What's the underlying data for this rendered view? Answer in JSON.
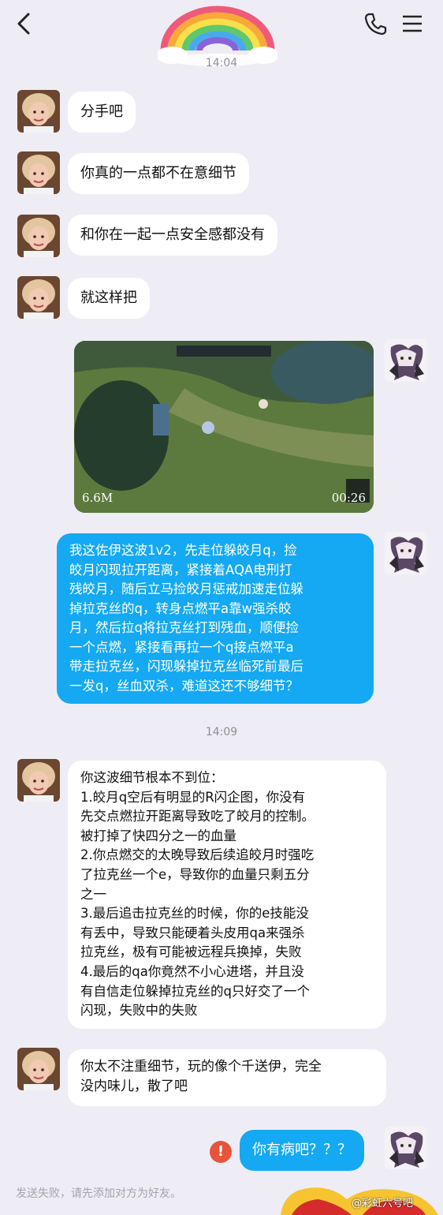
{
  "header": {
    "back_icon": "chevron-left-icon",
    "phone_icon": "phone-icon",
    "menu_icon": "hamburger-menu-icon",
    "decoration": "rainbow"
  },
  "timestamps": [
    "14:04",
    "14:09"
  ],
  "messages": [
    {
      "side": "left",
      "text": "分手吧"
    },
    {
      "side": "left",
      "text": "你真的一点都不在意细节"
    },
    {
      "side": "left",
      "text": "和你在一起一点安全感都没有"
    },
    {
      "side": "left",
      "text": "就这样把"
    },
    {
      "side": "right",
      "type": "video",
      "size": "6.6M",
      "duration": "00:26"
    },
    {
      "side": "right",
      "lines": [
        "我这佐伊这波1v2，先走位躲皎月q，捡",
        "皎月闪现拉开距离，紧接着AQA电刑打",
        "残皎月，随后立马捡皎月惩戒加速走位躲",
        "掉拉克丝的q，转身点燃平a靠w强杀皎",
        "月，然后拉q将拉克丝打到残血，顺便捡",
        "一个点燃，紧接看再拉一个q接点燃平a",
        "带走拉克丝，闪现躲掉拉克丝临死前最后",
        "一发q，丝血双杀，难道这还不够细节？"
      ]
    },
    {
      "side": "left",
      "lines": [
        "你这波细节根本不到位：",
        "1.皎月q空后有明显的R闪企图，你没有",
        "先交点燃拉开距离导致吃了皎月的控制。",
        "被打掉了快四分之一的血量",
        "2.你点燃交的太晚导致后续追皎月时强吃",
        "了拉克丝一个e，导致你的血量只剩五分",
        "之一",
        "3.最后追击拉克丝的时候，你的e技能没",
        "有丢中，导致只能硬着头皮用qa来强杀",
        "拉克丝，极有可能被远程兵换掉，失败",
        "4.最后的qa你竟然不小心进塔，并且没",
        "有自信走位躲掉拉克丝的q只好交了一个",
        "闪现，失败中的失败"
      ]
    },
    {
      "side": "left",
      "lines": [
        "你太不注重细节，玩的像个千送伊，完全",
        "没内味儿，散了吧"
      ]
    },
    {
      "side": "right",
      "text": "你有病吧？？？",
      "failed": true
    }
  ],
  "failed_icon": "!",
  "system_notice": "发送失败，请先添加对方为好友。",
  "watermark": "@彩虹六号吧",
  "colors": {
    "background": "#eeedf6",
    "bubble_self": "#14a9f2",
    "bubble_other": "#ffffff",
    "failed": "#e8533c"
  }
}
